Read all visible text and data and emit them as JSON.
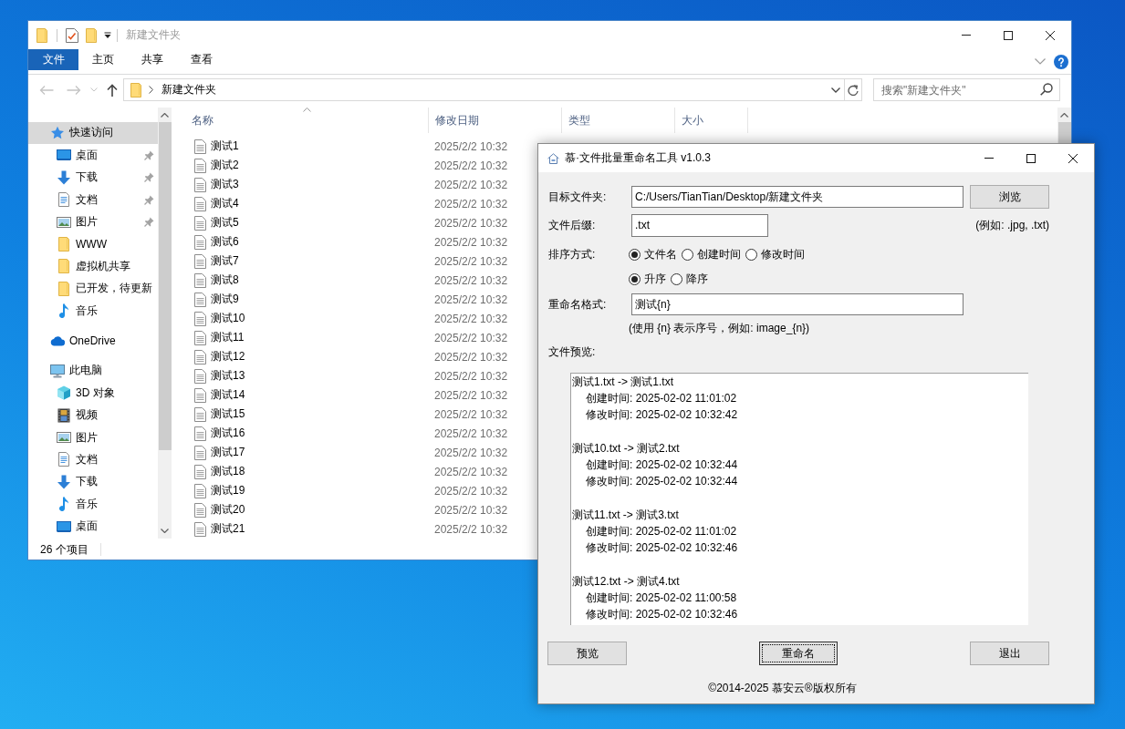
{
  "explorer": {
    "window": {
      "title": "新建文件夹",
      "active": false
    },
    "ribbon": {
      "tabs": [
        {
          "label": "文件",
          "kind": "menu"
        },
        {
          "label": "主页",
          "kind": "tab"
        },
        {
          "label": "共享",
          "kind": "tab"
        },
        {
          "label": "查看",
          "kind": "tab"
        }
      ]
    },
    "navigation": [
      {
        "kind": "back",
        "disabled": true
      },
      {
        "kind": "forward",
        "disabled": true
      },
      {
        "kind": "recent",
        "disabled": true
      },
      {
        "kind": "up",
        "disabled": false
      }
    ],
    "address": {
      "path": [
        "新建文件夹"
      ]
    },
    "search": {
      "placeholder": "搜索\"新建文件夹\""
    },
    "sidebar": {
      "items": [
        {
          "label": "快速访问",
          "kind": "star",
          "selected": true,
          "children": [
            {
              "label": "桌面",
              "kind": "desktop",
              "pinned": true,
              "selected": false
            },
            {
              "label": "下载",
              "kind": "download",
              "pinned": true,
              "selected": false
            },
            {
              "label": "文档",
              "kind": "documents",
              "pinned": true,
              "selected": false
            },
            {
              "label": "图片",
              "kind": "pictures",
              "pinned": true,
              "selected": false
            },
            {
              "label": "WWW",
              "kind": "folder",
              "pinned": false,
              "selected": false
            },
            {
              "label": "虚拟机共享",
              "kind": "folder",
              "pinned": false,
              "selected": false
            },
            {
              "label": "已开发，待更新",
              "kind": "folder",
              "pinned": false,
              "selected": false
            },
            {
              "label": "音乐",
              "kind": "music",
              "pinned": false,
              "selected": false
            }
          ]
        },
        {
          "label": "OneDrive",
          "kind": "cloud",
          "selected": false
        },
        {
          "label": "此电脑",
          "kind": "computer",
          "selected": false,
          "children": [
            {
              "label": "3D 对象",
              "kind": "objects3d",
              "pinned": false,
              "selected": false
            },
            {
              "label": "视频",
              "kind": "videos",
              "pinned": false,
              "selected": false
            },
            {
              "label": "图片",
              "kind": "pictures",
              "pinned": false,
              "selected": false
            },
            {
              "label": "文档",
              "kind": "documents",
              "pinned": false,
              "selected": false
            },
            {
              "label": "下载",
              "kind": "download",
              "pinned": false,
              "selected": false
            },
            {
              "label": "音乐",
              "kind": "music",
              "pinned": false,
              "selected": false
            },
            {
              "label": "桌面",
              "kind": "desktop",
              "pinned": false,
              "selected": false
            }
          ]
        }
      ]
    },
    "columns": [
      {
        "label": "名称",
        "sorted": true
      },
      {
        "label": "修改日期",
        "sorted": false
      },
      {
        "label": "类型",
        "sorted": false
      },
      {
        "label": "大小",
        "sorted": false
      }
    ],
    "files": [
      {
        "name": "测试1",
        "modified": "2025/2/2 10:32"
      },
      {
        "name": "测试2",
        "modified": "2025/2/2 10:32"
      },
      {
        "name": "测试3",
        "modified": "2025/2/2 10:32"
      },
      {
        "name": "测试4",
        "modified": "2025/2/2 10:32"
      },
      {
        "name": "测试5",
        "modified": "2025/2/2 10:32"
      },
      {
        "name": "测试6",
        "modified": "2025/2/2 10:32"
      },
      {
        "name": "测试7",
        "modified": "2025/2/2 10:32"
      },
      {
        "name": "测试8",
        "modified": "2025/2/2 10:32"
      },
      {
        "name": "测试9",
        "modified": "2025/2/2 10:32"
      },
      {
        "name": "测试10",
        "modified": "2025/2/2 10:32"
      },
      {
        "name": "测试11",
        "modified": "2025/2/2 10:32"
      },
      {
        "name": "测试12",
        "modified": "2025/2/2 10:32"
      },
      {
        "name": "测试13",
        "modified": "2025/2/2 10:32"
      },
      {
        "name": "测试14",
        "modified": "2025/2/2 10:32"
      },
      {
        "name": "测试15",
        "modified": "2025/2/2 10:32"
      },
      {
        "name": "测试16",
        "modified": "2025/2/2 10:32"
      },
      {
        "name": "测试17",
        "modified": "2025/2/2 10:32"
      },
      {
        "name": "测试18",
        "modified": "2025/2/2 10:32"
      },
      {
        "name": "测试19",
        "modified": "2025/2/2 10:32"
      },
      {
        "name": "测试20",
        "modified": "2025/2/2 10:32"
      },
      {
        "name": "测试21",
        "modified": "2025/2/2 10:32"
      }
    ],
    "status_bar": "26 个项目"
  },
  "dialog": {
    "window": {
      "title": "慕·文件批量重命名工具 v1.0.3",
      "active": true
    },
    "target_folder": {
      "label": "目标文件夹:",
      "value": "C:/Users/TianTian/Desktop/新建文件夹",
      "button": "浏览"
    },
    "suffix": {
      "label": "文件后缀:",
      "value": ".txt",
      "hint": "(例如: .jpg, .txt)"
    },
    "sort": {
      "label": "排序方式:",
      "by": [
        {
          "label": "文件名",
          "selected": true
        },
        {
          "label": "创建时间",
          "selected": false
        },
        {
          "label": "修改时间",
          "selected": false
        }
      ],
      "order": [
        {
          "label": "升序",
          "selected": true
        },
        {
          "label": "降序",
          "selected": false
        }
      ]
    },
    "format": {
      "label": "重命名格式:",
      "value": "测试{n}",
      "hint": "(使用 {n} 表示序号，例如: image_{n})"
    },
    "preview": {
      "label": "文件预览:",
      "entries": [
        {
          "mapping": "测试1.txt -> 测试1.txt",
          "created": "创建时间: 2025-02-02 11:01:02",
          "modified": "修改时间: 2025-02-02 10:32:42"
        },
        {
          "mapping": "测试10.txt -> 测试2.txt",
          "created": "创建时间: 2025-02-02 10:32:44",
          "modified": "修改时间: 2025-02-02 10:32:44"
        },
        {
          "mapping": "测试11.txt -> 测试3.txt",
          "created": "创建时间: 2025-02-02 11:01:02",
          "modified": "修改时间: 2025-02-02 10:32:46"
        },
        {
          "mapping": "测试12.txt -> 测试4.txt",
          "created": "创建时间: 2025-02-02 11:00:58",
          "modified": "修改时间: 2025-02-02 10:32:46"
        }
      ]
    },
    "buttons": [
      {
        "label": "预览",
        "focused": false
      },
      {
        "label": "重命名",
        "focused": true
      },
      {
        "label": "退出",
        "focused": false
      }
    ],
    "footer": "©2014-2025 慕安云®版权所有"
  }
}
